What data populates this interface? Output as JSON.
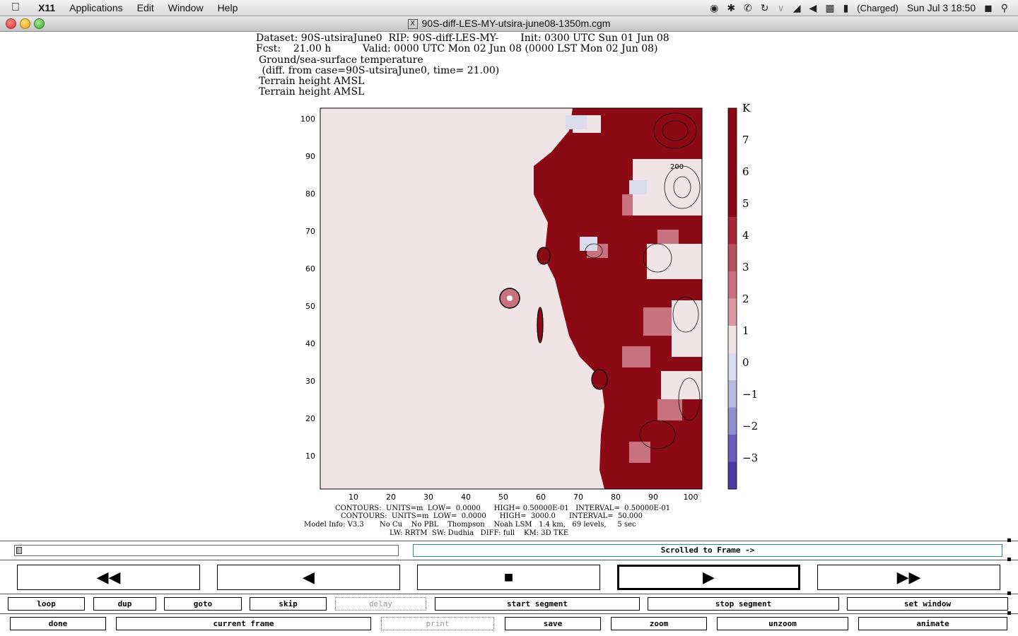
{
  "menubar": {
    "app": "X11",
    "items": [
      "Applications",
      "Edit",
      "Window",
      "Help"
    ],
    "battery": "(Charged)",
    "clock": "Sun Jul 3  18:50"
  },
  "window": {
    "title": "90S-diff-LES-MY-utsira-june08-1350m.cgm"
  },
  "header": {
    "line1": "Dataset: 90S-utsiraJune0  RIP: 90S-diff-LES-MY-       Init: 0300 UTC Sun 01 Jun 08",
    "line2": "Fcst:    21.00 h          Valid: 0000 UTC Mon 02 Jun 08 (0000 LST Mon 02 Jun 08)",
    "line3": "Ground/sea-surface temperature",
    "line4": " (diff. from case=90S-utsiraJune0, time= 21.00)",
    "line5": "Terrain height AMSL",
    "line6": "Terrain height AMSL"
  },
  "plot": {
    "y_ticks": [
      "100",
      "90",
      "80",
      "70",
      "60",
      "50",
      "40",
      "30",
      "20",
      "10"
    ],
    "x_ticks": [
      "10",
      "20",
      "30",
      "40",
      "50",
      "60",
      "70",
      "80",
      "90",
      "100"
    ],
    "contour_label": "200",
    "colorbar_unit": "K",
    "colorbar_ticks": [
      "7",
      "6",
      "5",
      "4",
      "3",
      "2",
      "1",
      "0",
      "−1",
      "−2",
      "−3"
    ],
    "colorbar_colors": [
      "#8b0a14",
      "#8b0a14",
      "#8b0a14",
      "#8b0a14",
      "#a8283a",
      "#b8505e",
      "#c7727e",
      "#d89aa2",
      "#f1e4e6",
      "#dcdcef",
      "#b9b9e0",
      "#9090cc",
      "#6a5eb8",
      "#4c3aa6"
    ],
    "ocean_color": "#f1e4e6",
    "land_color": "#8b0a14"
  },
  "footer": {
    "line1": "CONTOURS:  UNITS=m  LOW=  0.0000      HIGH= 0.50000E-01   INTERVAL=  0.50000E-01",
    "line2": "CONTOURS:  UNITS=m  LOW=  0.0000      HIGH=  3000.0      INTERVAL=  50.000",
    "line3": "Model Info: V3.3       No Cu    No PBL    Thompson    Noah LSM   1.4 km,   69 levels,     5 sec",
    "line4": "LW: RRTM  SW: Dudhia   DIFF: full    KM: 3D TKE"
  },
  "controls": {
    "status": "Scrolled to Frame ->",
    "transport": [
      "◀◀",
      "◀",
      "■",
      "▶",
      "▶▶"
    ],
    "row1": [
      "loop",
      "dup",
      "goto",
      "skip",
      "delay",
      "start segment",
      "stop segment",
      "set window"
    ],
    "row2": [
      "done",
      "current frame",
      "print",
      "save",
      "zoom",
      "unzoom",
      "animate"
    ]
  }
}
